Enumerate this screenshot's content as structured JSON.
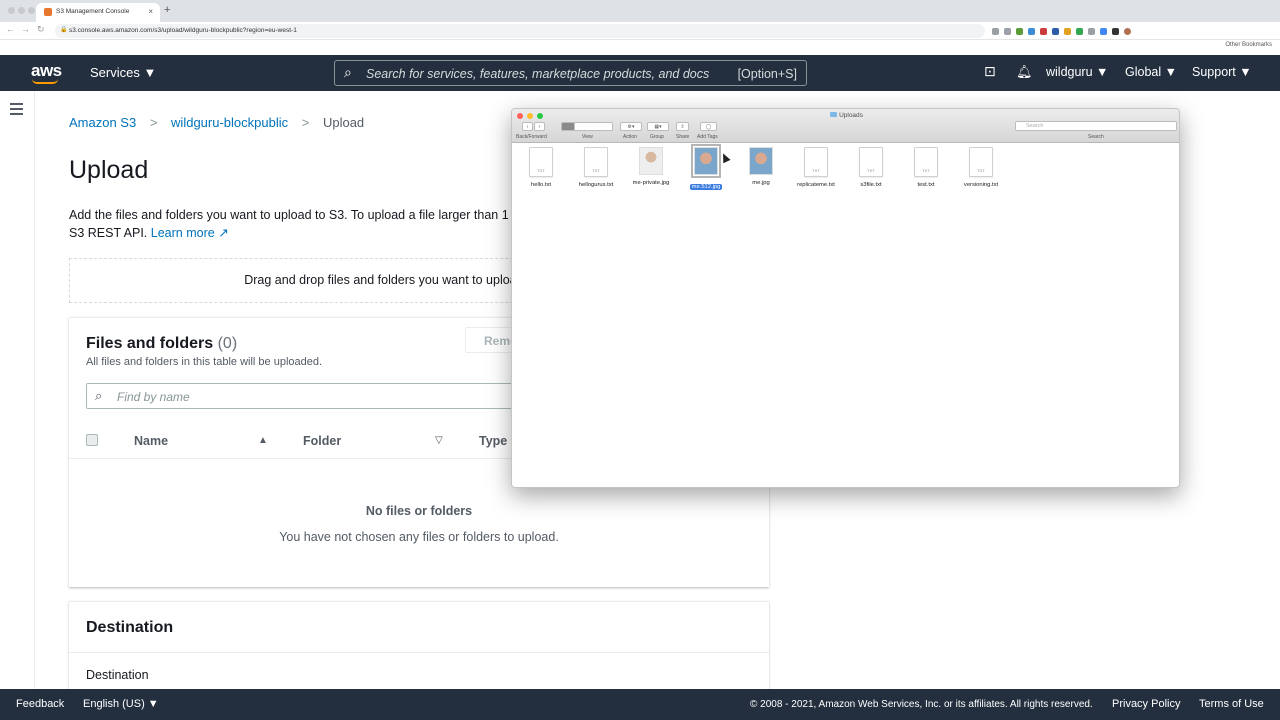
{
  "browser": {
    "tab_title": "S3 Management Console",
    "tab_close": "×",
    "new_tab": "+",
    "url": "s3.console.aws.amazon.com/s3/upload/wildguru-blockpublic?region=eu-west-1",
    "other_bookmarks": "Other Bookmarks",
    "back": "←",
    "forward": "→",
    "reload": "↻"
  },
  "aws_nav": {
    "logo": "aws",
    "services": "Services ▼",
    "search_placeholder": "Search for services, features, marketplace products, and docs",
    "search_shortcut": "[Option+S]",
    "user": "wildguru ▼",
    "region": "Global ▼",
    "support": "Support ▼"
  },
  "breadcrumb": {
    "items": [
      "Amazon S3",
      "wildguru-blockpublic",
      "Upload"
    ],
    "separator": ">"
  },
  "page": {
    "title": "Upload",
    "desc_part1": "Add the files and folders you want to upload to S3. To upload a file larger than 1",
    "desc_part2": "S3 REST API.",
    "learn_more": "Learn more",
    "drop_zone": "Drag and drop files and folders you want to upload here, or cho"
  },
  "files_panel": {
    "title": "Files and folders",
    "count": "(0)",
    "subtitle": "All files and folders in this table will be uploaded.",
    "remove": "Remo",
    "find_placeholder": "Find by name",
    "columns": [
      "Name",
      "Folder",
      "Type"
    ],
    "empty_title": "No files or folders",
    "empty_sub": "You have not chosen any files or folders to upload."
  },
  "destination": {
    "title": "Destination",
    "label": "Destination"
  },
  "footer": {
    "feedback": "Feedback",
    "language": "English (US) ▼",
    "copyright": "© 2008 - 2021, Amazon Web Services, Inc. or its affiliates. All rights reserved.",
    "privacy": "Privacy Policy",
    "terms": "Terms of Use"
  },
  "finder": {
    "title": "Uploads",
    "toolbar_labels": [
      "Back/Forward",
      "View",
      "Action",
      "Group",
      "Share",
      "Add Tags"
    ],
    "search_placeholder": "Search",
    "search_label": "Search",
    "files": [
      {
        "name": "hello.txt",
        "kind": "doc"
      },
      {
        "name": "hellogurus.txt",
        "kind": "doc"
      },
      {
        "name": "me-private.jpg",
        "kind": "img"
      },
      {
        "name": "me.512.jpg",
        "kind": "img",
        "selected": true
      },
      {
        "name": "me.jpg",
        "kind": "img"
      },
      {
        "name": "replicateme.txt",
        "kind": "doc"
      },
      {
        "name": "s3file.txt",
        "kind": "doc"
      },
      {
        "name": "test.txt",
        "kind": "doc"
      },
      {
        "name": "versioning.txt",
        "kind": "doc"
      }
    ],
    "doc_badge": "TXT"
  },
  "colors": {
    "aws_nav": "#232f3e",
    "aws_orange": "#ff9900",
    "link": "#0073bb",
    "finder_selection": "#3b7ce0"
  }
}
